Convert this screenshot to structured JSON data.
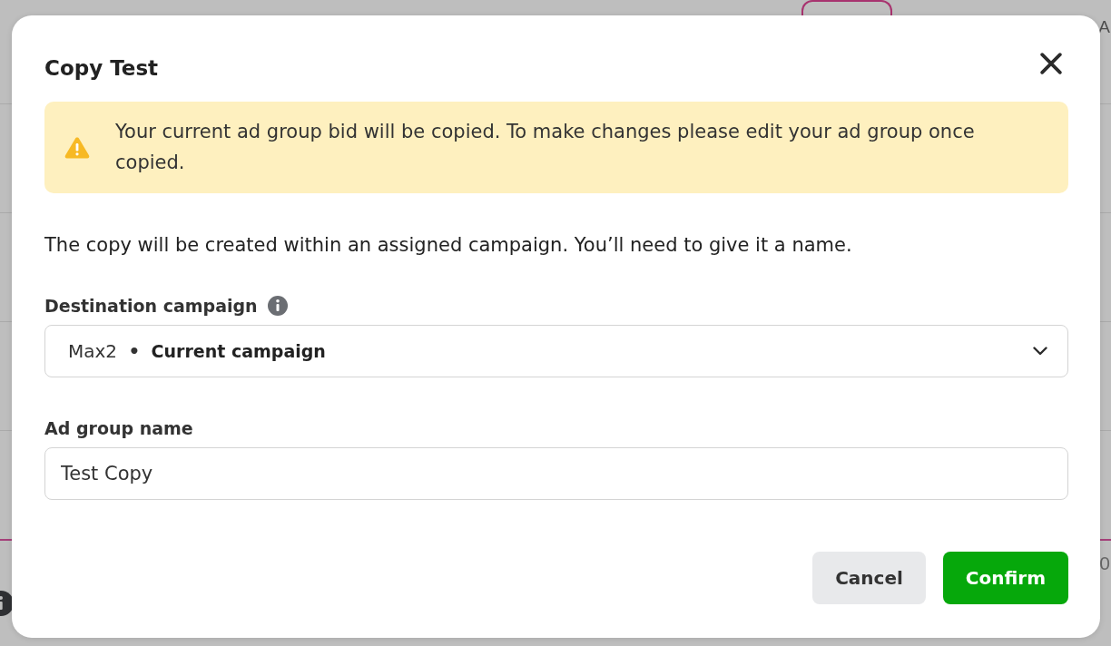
{
  "page_behind": {
    "texts": [
      "A",
      "0"
    ]
  },
  "dialog": {
    "title": "Copy Test",
    "alert": {
      "kind": "warning",
      "text": "Your current ad group bid will be copied. To make changes please edit your ad group once copied."
    },
    "description": "The copy will be created within an assigned campaign. You’ll need to give it a name.",
    "fields": [
      {
        "kind": "select",
        "label": "Destination campaign",
        "info_icon": true,
        "value": "Max2",
        "separator": "•",
        "detail": "Current campaign"
      },
      {
        "kind": "text",
        "label": "Ad group name",
        "info_icon": false,
        "value": "Test Copy"
      }
    ],
    "buttons": [
      {
        "kind": "secondary",
        "label": "Cancel"
      },
      {
        "kind": "primary",
        "label": "Confirm"
      }
    ]
  }
}
